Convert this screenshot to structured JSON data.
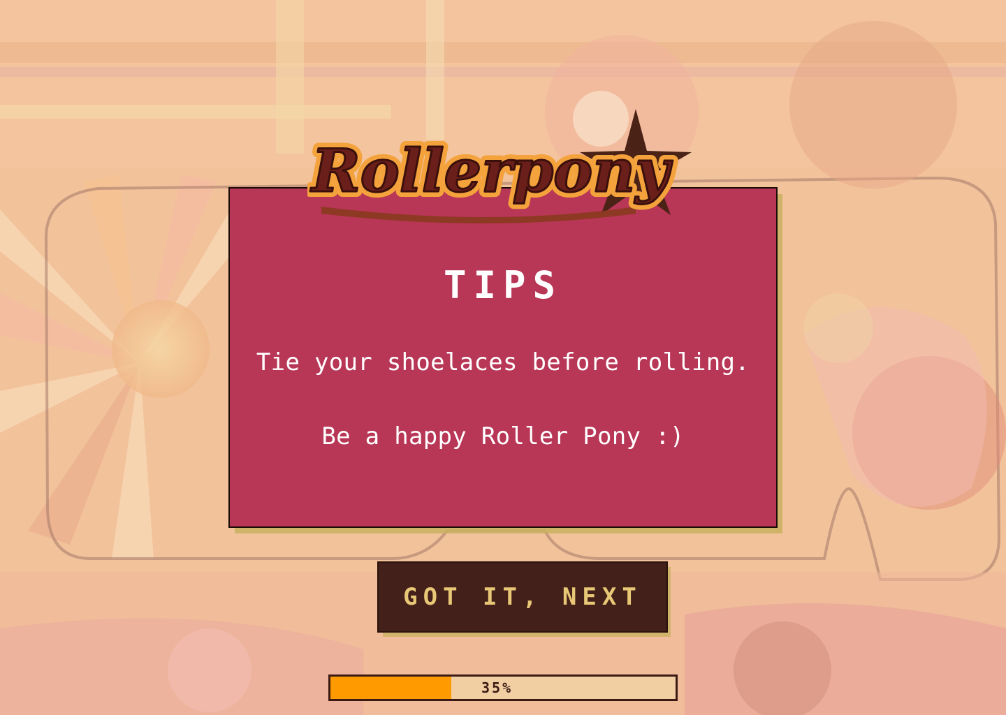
{
  "logo": {
    "text": "Rollerpony"
  },
  "tips_card": {
    "title": "TIPS",
    "lines": [
      "Tie your shoelaces before rolling.",
      "Be a happy Roller Pony :)"
    ]
  },
  "next_button": {
    "label": "GOT IT, NEXT"
  },
  "progress": {
    "value": 0.35,
    "label": "35%"
  },
  "colors": {
    "card": "#b83656",
    "button": "#43201a",
    "button_text": "#e8c876",
    "progress_fill": "#ff9b00",
    "logo_fill": "#6b1f1a",
    "logo_outline": "#f3a23c",
    "star": "#4a2216"
  },
  "icons": [
    "star-icon"
  ]
}
